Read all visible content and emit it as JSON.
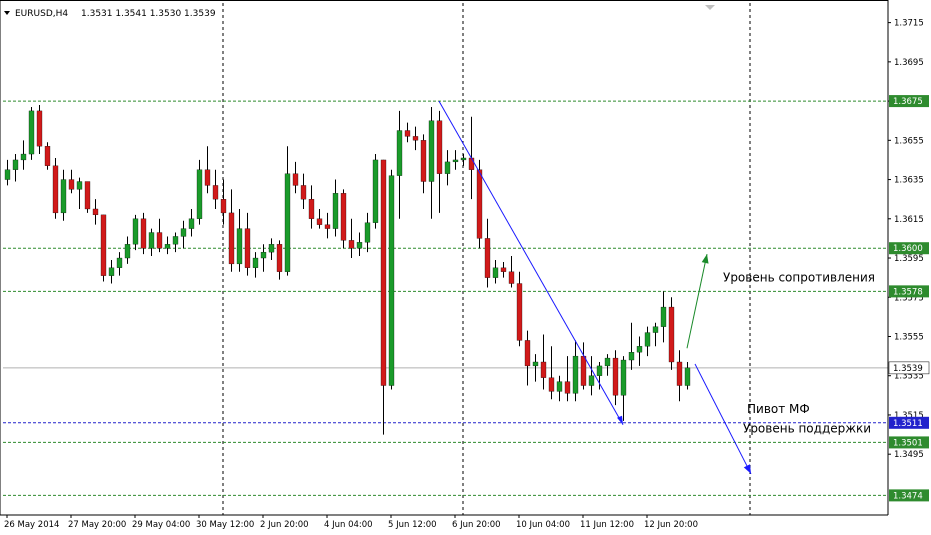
{
  "window": {
    "symbol_title": "EURUSD,H4",
    "ohlc_text": "1.3531 1.3541 1.3530 1.3539"
  },
  "colors": {
    "background": "#ffffff",
    "frame": "#000000",
    "bull_candle": "#1a9b2a",
    "bear_candle": "#d11a1a",
    "wick": "#000000",
    "grid": "#000000",
    "green_levels": "#2e8b2e",
    "blue_levels": "#2222cc",
    "trend_line": "#1a1aff",
    "up_arrow": "#1a8a2a",
    "down_arrow": "#1a1aff",
    "price_marker": "#b0b0b0"
  },
  "chart_data": {
    "type": "candlestick",
    "timeframe": "H4",
    "ylim": [
      1.3464,
      1.3725
    ],
    "y_ticks": [
      1.3715,
      1.3695,
      1.3675,
      1.3655,
      1.3635,
      1.3615,
      1.3595,
      1.3575,
      1.3555,
      1.3535,
      1.3515,
      1.3495
    ],
    "x_tick_labels": [
      {
        "index": 0,
        "label": "26 May 2014"
      },
      {
        "index": 8,
        "label": "27 May 20:00"
      },
      {
        "index": 16,
        "label": "29 May 04:00"
      },
      {
        "index": 24,
        "label": "30 May 12:00"
      },
      {
        "index": 32,
        "label": "2 Jun 20:00"
      },
      {
        "index": 40,
        "label": "4 Jun 04:00"
      },
      {
        "index": 48,
        "label": "5 Jun 12:00"
      },
      {
        "index": 56,
        "label": "6 Jun 20:00"
      },
      {
        "index": 64,
        "label": "10 Jun 04:00"
      },
      {
        "index": 72,
        "label": "11 Jun 12:00"
      },
      {
        "index": 80,
        "label": "12 Jun 20:00"
      }
    ],
    "vertical_grid_indices": [
      27,
      57
    ],
    "current_price": 1.3539,
    "candles": [
      [
        1.3635,
        1.3645,
        1.3632,
        1.364
      ],
      [
        1.364,
        1.3648,
        1.3634,
        1.3645
      ],
      [
        1.3645,
        1.3655,
        1.364,
        1.3648
      ],
      [
        1.3648,
        1.3672,
        1.3645,
        1.367
      ],
      [
        1.367,
        1.3673,
        1.3648,
        1.3652
      ],
      [
        1.3652,
        1.3654,
        1.364,
        1.3642
      ],
      [
        1.3642,
        1.3646,
        1.3615,
        1.3618
      ],
      [
        1.3618,
        1.364,
        1.3614,
        1.3635
      ],
      [
        1.3635,
        1.364,
        1.3628,
        1.363
      ],
      [
        1.363,
        1.3636,
        1.362,
        1.3634
      ],
      [
        1.3634,
        1.3634,
        1.3618,
        1.362
      ],
      [
        1.362,
        1.3625,
        1.3612,
        1.3617
      ],
      [
        1.3617,
        1.3617,
        1.3583,
        1.3586
      ],
      [
        1.3586,
        1.3594,
        1.3582,
        1.359
      ],
      [
        1.359,
        1.3598,
        1.3586,
        1.3595
      ],
      [
        1.3595,
        1.3606,
        1.3592,
        1.3602
      ],
      [
        1.3602,
        1.3617,
        1.3599,
        1.3615
      ],
      [
        1.3615,
        1.3618,
        1.3597,
        1.36
      ],
      [
        1.36,
        1.361,
        1.3596,
        1.3608
      ],
      [
        1.3608,
        1.3615,
        1.3598,
        1.36
      ],
      [
        1.36,
        1.3606,
        1.3597,
        1.3602
      ],
      [
        1.3602,
        1.3608,
        1.3598,
        1.3606
      ],
      [
        1.3606,
        1.3614,
        1.36,
        1.361
      ],
      [
        1.361,
        1.362,
        1.3606,
        1.3615
      ],
      [
        1.3615,
        1.3645,
        1.3612,
        1.364
      ],
      [
        1.364,
        1.3652,
        1.3628,
        1.3632
      ],
      [
        1.3632,
        1.364,
        1.362,
        1.3625
      ],
      [
        1.3625,
        1.3635,
        1.3612,
        1.3618
      ],
      [
        1.3618,
        1.363,
        1.3588,
        1.3592
      ],
      [
        1.3592,
        1.362,
        1.3588,
        1.361
      ],
      [
        1.361,
        1.3618,
        1.3586,
        1.359
      ],
      [
        1.359,
        1.3598,
        1.3585,
        1.3595
      ],
      [
        1.3595,
        1.3602,
        1.3588,
        1.3598
      ],
      [
        1.3598,
        1.3605,
        1.3594,
        1.3602
      ],
      [
        1.3602,
        1.3604,
        1.3584,
        1.3588
      ],
      [
        1.3588,
        1.3652,
        1.3586,
        1.3638
      ],
      [
        1.3638,
        1.3644,
        1.3628,
        1.3632
      ],
      [
        1.3632,
        1.3638,
        1.362,
        1.3625
      ],
      [
        1.3625,
        1.3632,
        1.361,
        1.3615
      ],
      [
        1.3615,
        1.362,
        1.361,
        1.3612
      ],
      [
        1.3612,
        1.3618,
        1.3605,
        1.361
      ],
      [
        1.361,
        1.3635,
        1.3606,
        1.3628
      ],
      [
        1.3628,
        1.363,
        1.36,
        1.3604
      ],
      [
        1.3604,
        1.3615,
        1.3595,
        1.36
      ],
      [
        1.36,
        1.3608,
        1.3596,
        1.3603
      ],
      [
        1.3603,
        1.3618,
        1.3598,
        1.3613
      ],
      [
        1.3613,
        1.3648,
        1.361,
        1.3645
      ],
      [
        1.3645,
        1.3645,
        1.3505,
        1.353
      ],
      [
        1.353,
        1.364,
        1.3528,
        1.3637
      ],
      [
        1.3637,
        1.367,
        1.3615,
        1.366
      ],
      [
        1.366,
        1.3664,
        1.3654,
        1.3657
      ],
      [
        1.3657,
        1.3662,
        1.365,
        1.3655
      ],
      [
        1.3655,
        1.3658,
        1.3628,
        1.3634
      ],
      [
        1.3634,
        1.3672,
        1.3615,
        1.3665
      ],
      [
        1.3665,
        1.367,
        1.3618,
        1.3638
      ],
      [
        1.3638,
        1.365,
        1.3632,
        1.3644
      ],
      [
        1.3644,
        1.365,
        1.364,
        1.3645
      ],
      [
        1.3645,
        1.3648,
        1.3642,
        1.3646
      ],
      [
        1.3646,
        1.3667,
        1.3625,
        1.364
      ],
      [
        1.364,
        1.3645,
        1.36,
        1.3605
      ],
      [
        1.3605,
        1.3615,
        1.358,
        1.3585
      ],
      [
        1.3585,
        1.3594,
        1.3582,
        1.359
      ],
      [
        1.359,
        1.3593,
        1.3585,
        1.3588
      ],
      [
        1.3588,
        1.3596,
        1.358,
        1.3582
      ],
      [
        1.3582,
        1.3588,
        1.355,
        1.3553
      ],
      [
        1.3553,
        1.3558,
        1.353,
        1.354
      ],
      [
        1.354,
        1.3546,
        1.3532,
        1.3542
      ],
      [
        1.3542,
        1.3556,
        1.3528,
        1.3534
      ],
      [
        1.3534,
        1.355,
        1.3523,
        1.3527
      ],
      [
        1.3527,
        1.3535,
        1.3522,
        1.3532
      ],
      [
        1.3532,
        1.3545,
        1.3522,
        1.3526
      ],
      [
        1.3526,
        1.3553,
        1.3522,
        1.3545
      ],
      [
        1.3545,
        1.3552,
        1.3528,
        1.353
      ],
      [
        1.353,
        1.3545,
        1.3525,
        1.3535
      ],
      [
        1.3535,
        1.3542,
        1.3528,
        1.354
      ],
      [
        1.354,
        1.3546,
        1.3535,
        1.3544
      ],
      [
        1.3544,
        1.3548,
        1.352,
        1.3525
      ],
      [
        1.3525,
        1.3545,
        1.3512,
        1.3543
      ],
      [
        1.3543,
        1.3562,
        1.3538,
        1.3547
      ],
      [
        1.3547,
        1.3555,
        1.354,
        1.355
      ],
      [
        1.355,
        1.356,
        1.3545,
        1.3557
      ],
      [
        1.3557,
        1.3562,
        1.355,
        1.356
      ],
      [
        1.356,
        1.3578,
        1.3552,
        1.357
      ],
      [
        1.357,
        1.3575,
        1.3538,
        1.3542
      ],
      [
        1.3542,
        1.3548,
        1.3522,
        1.353
      ],
      [
        1.353,
        1.3542,
        1.3528,
        1.3539
      ]
    ],
    "horizontal_levels": [
      {
        "price": 1.3675,
        "label": "1.3675",
        "color": "green"
      },
      {
        "price": 1.36,
        "label": "1.3600",
        "color": "green"
      },
      {
        "price": 1.3578,
        "label": "1.3578",
        "color": "green"
      },
      {
        "price": 1.3511,
        "label": "1.3511",
        "color": "blue"
      },
      {
        "price": 1.3501,
        "label": "1.3501",
        "color": "green"
      },
      {
        "price": 1.3474,
        "label": "1.3474",
        "color": "green"
      }
    ],
    "trend_line": {
      "from": [
        54,
        1.3675
      ],
      "to": [
        77,
        1.351
      ]
    },
    "arrows": [
      {
        "from": [
          85,
          1.3549
        ],
        "to": [
          87.5,
          1.3597
        ],
        "color": "up"
      },
      {
        "from": [
          86,
          1.3541
        ],
        "to": [
          93,
          1.3485
        ],
        "color": "down"
      }
    ],
    "annotations": [
      {
        "text": "Уровень сопротивления",
        "x_index": 89.5,
        "price": 1.358
      },
      {
        "text": "Пивот МФ",
        "x_index": 92.5,
        "price": 1.3513
      },
      {
        "text": "Уровень поддержки",
        "x_index": 92,
        "price": 1.3503
      }
    ]
  }
}
